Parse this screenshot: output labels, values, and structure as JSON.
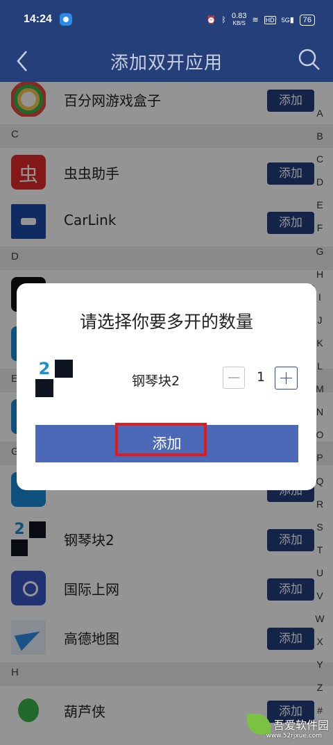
{
  "status_bar": {
    "time": "14:24",
    "network_speed": "0.83",
    "network_unit": "KB/S",
    "hd_label": "HD",
    "signal_label": "5G",
    "battery": "76"
  },
  "header": {
    "title": "添加双开应用",
    "back_icon": "chevron-left-icon",
    "search_icon": "search-icon"
  },
  "list": {
    "add_label": "添加",
    "items": [
      {
        "type": "app",
        "name": "百分网游戏盒子",
        "icon": "baifen"
      },
      {
        "type": "section",
        "letter": "C"
      },
      {
        "type": "app",
        "name": "虫虫助手",
        "icon": "chong"
      },
      {
        "type": "app",
        "name": "CarLink",
        "icon": "carlink"
      },
      {
        "type": "section",
        "letter": "D"
      },
      {
        "type": "app",
        "name": "",
        "icon": "dy"
      },
      {
        "type": "app",
        "name": "",
        "icon": "blue"
      },
      {
        "type": "section",
        "letter": "E"
      },
      {
        "type": "app",
        "name": "",
        "icon": "blue"
      },
      {
        "type": "section",
        "letter": "G"
      },
      {
        "type": "app",
        "name": "",
        "icon": "blue"
      },
      {
        "type": "app",
        "name": "钢琴块2",
        "icon": "piano"
      },
      {
        "type": "app",
        "name": "国际上网",
        "icon": "net"
      },
      {
        "type": "app",
        "name": "高德地图",
        "icon": "gaode"
      },
      {
        "type": "section",
        "letter": "H"
      },
      {
        "type": "app",
        "name": "葫芦侠",
        "icon": "hulu"
      }
    ]
  },
  "alphabet": [
    "A",
    "B",
    "C",
    "D",
    "E",
    "F",
    "G",
    "H",
    "I",
    "J",
    "K",
    "L",
    "M",
    "N",
    "O",
    "P",
    "Q",
    "R",
    "S",
    "T",
    "U",
    "V",
    "W",
    "X",
    "Y",
    "Z",
    "#"
  ],
  "dialog": {
    "title": "请选择你要多开的数量",
    "app_name": "钢琴块2",
    "app_icon_digit": "2",
    "quantity": "1",
    "add_label": "添加"
  },
  "watermark": {
    "text": "吾爱软件园",
    "sub": "www.52rjxue.com"
  },
  "colors": {
    "header": "#243f7a",
    "button": "#213e7c",
    "dialog_button": "#4b69b6",
    "highlight": "#e31b1b"
  }
}
